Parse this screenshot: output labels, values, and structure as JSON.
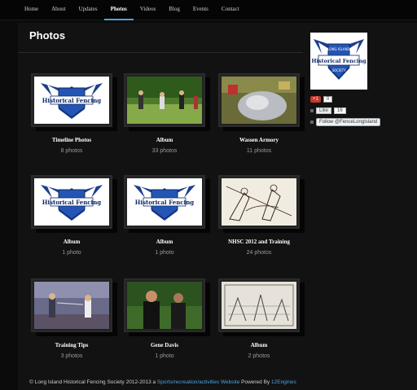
{
  "nav": {
    "items": [
      "Home",
      "About",
      "Updates",
      "Photos",
      "Videos",
      "Blog",
      "Events",
      "Contact"
    ],
    "active": "Photos"
  },
  "page": {
    "title": "Photos"
  },
  "albums": [
    {
      "title": "Timeline Photos",
      "count": "8 photos"
    },
    {
      "title": "Album",
      "count": "33 photos"
    },
    {
      "title": "Wassen Armory",
      "count": "11 photos"
    },
    {
      "title": "Album",
      "count": "1 photo"
    },
    {
      "title": "Album",
      "count": "1 photo"
    },
    {
      "title": "NHSC 2012 and Training",
      "count": "24 photos"
    },
    {
      "title": "Training Tips",
      "count": "3 photos"
    },
    {
      "title": "Gene Davis",
      "count": "1 photo"
    },
    {
      "title": "Album",
      "count": "2 photos"
    }
  ],
  "logo": {
    "top_text": "LONG ISLAND",
    "main_text": "Historical Fencing",
    "bottom_text": "SOCIETY"
  },
  "social": {
    "gplus_label": "+1",
    "gplus_count": "0",
    "like_label": "Like",
    "like_count": "16",
    "follow_label": "Follow @FenceLongIsland"
  },
  "footer": {
    "prefix": "© Long Island Historical Fencing Society 2012-2013 a ",
    "category_link": "Sports/recreation/activities Website",
    "powered_by": " Powered By ",
    "engine_link": "12Engines"
  },
  "colors": {
    "accent": "#4aa3df",
    "background": "#0b0b0b",
    "logo_blue": "#1d3f8f"
  }
}
